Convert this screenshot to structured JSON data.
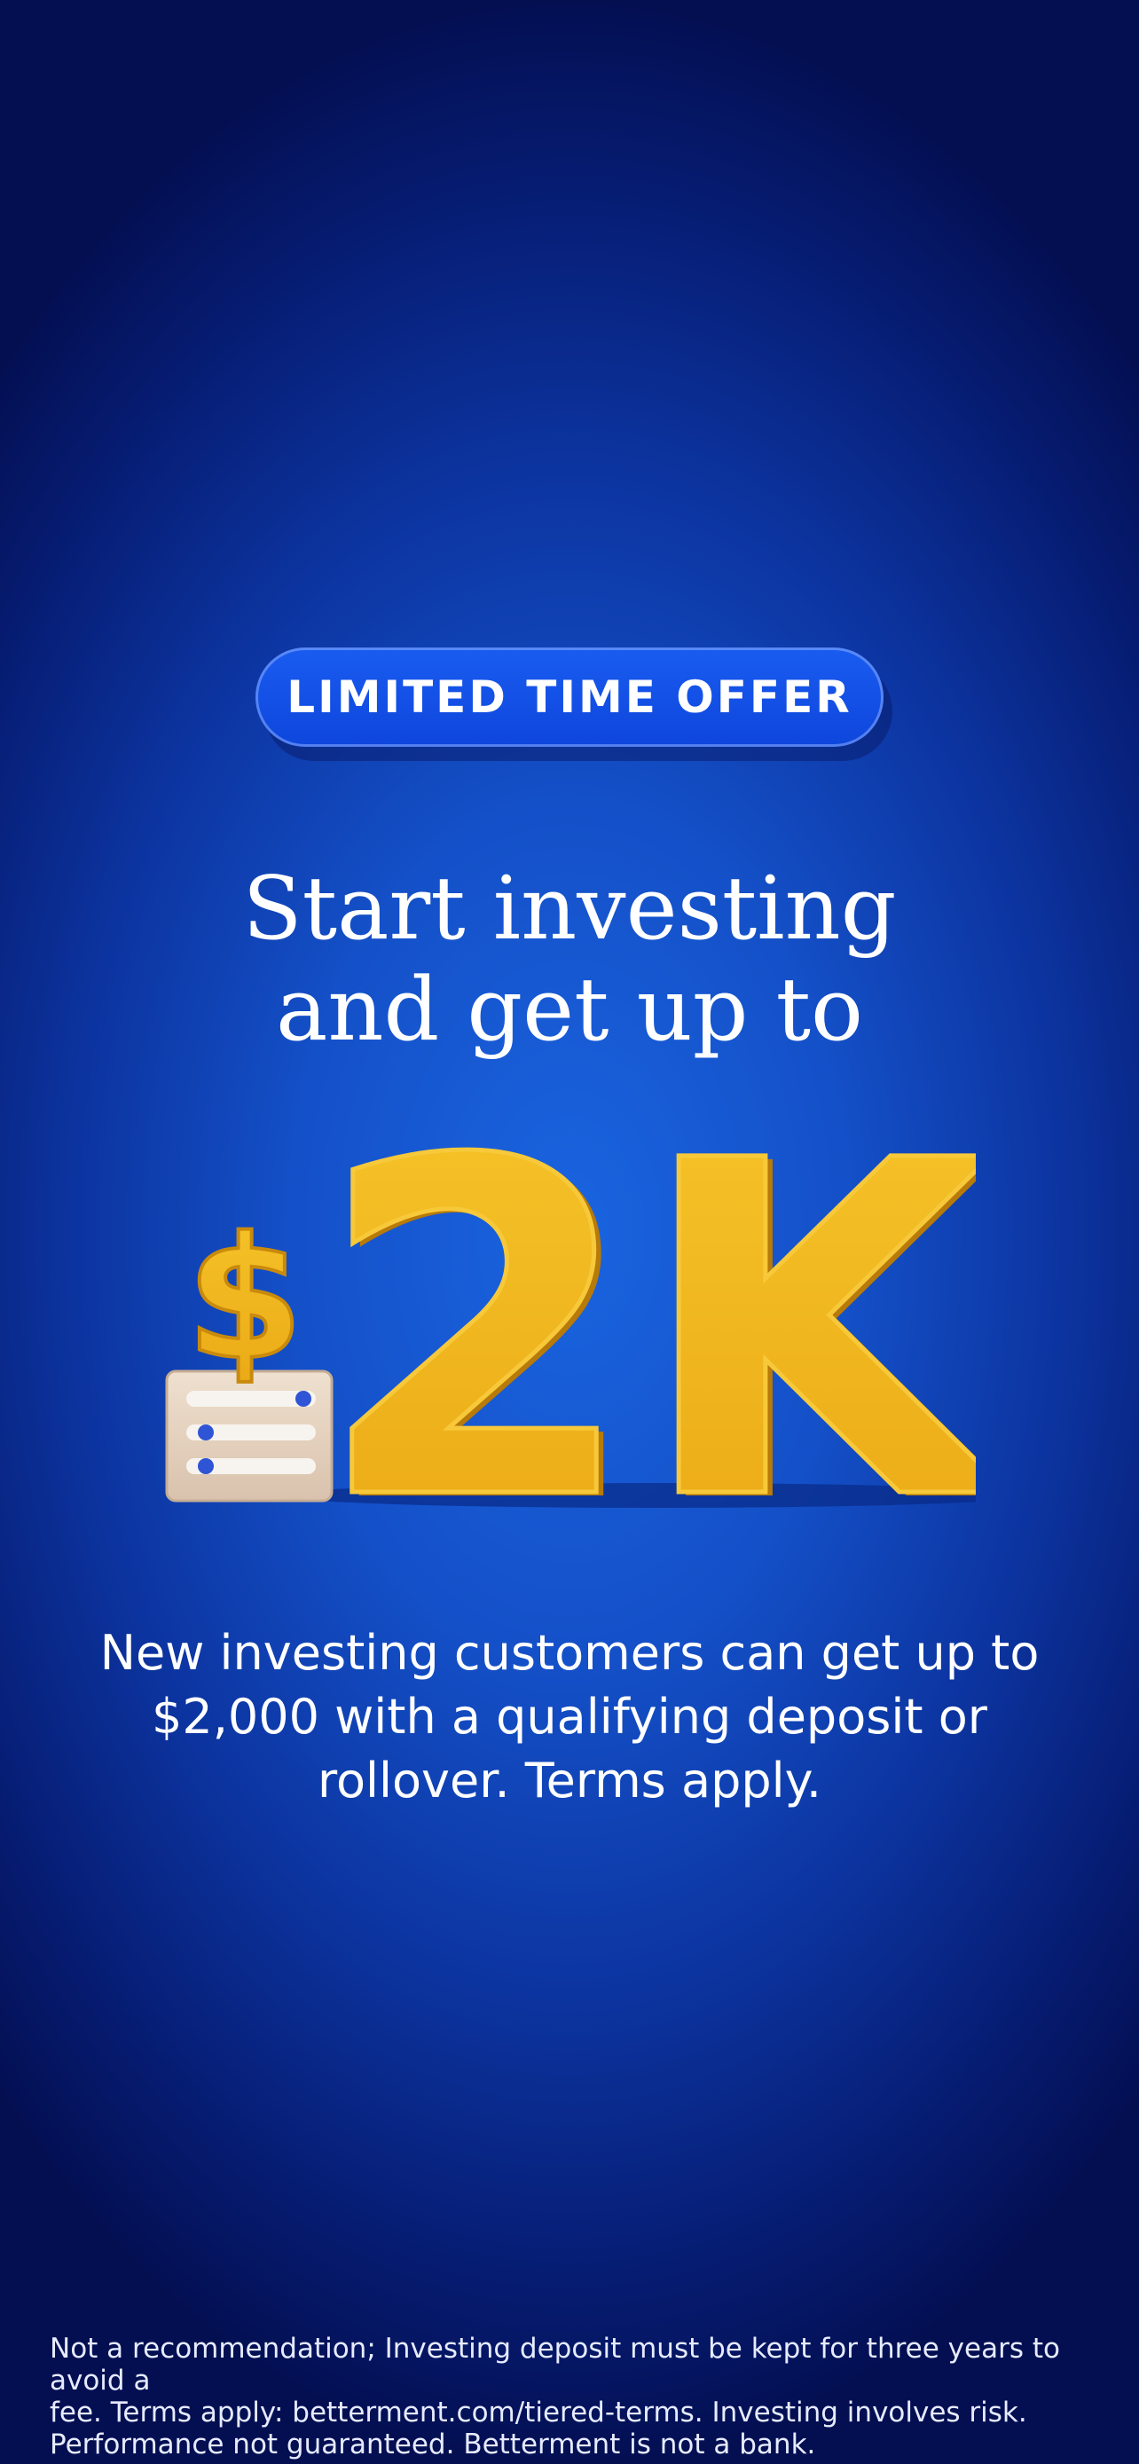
{
  "badge": {
    "label": "LIMITED TIME OFFER"
  },
  "headline": {
    "line1": "Start investing",
    "line2": "and get up to"
  },
  "hero": {
    "dollar_sign": "$",
    "amount": "2K",
    "icon": "dollar-on-box-icon"
  },
  "subtext": {
    "line1": "New investing customers can get up to",
    "line2": "$2,000 with a qualifying deposit or",
    "line3": "rollover. Terms apply."
  },
  "disclaimer": {
    "line1": "Not a recommendation; Investing deposit must be kept for three years to avoid a",
    "line2": "fee. Terms apply: betterment.com/tiered-terms. Investing involves risk.",
    "line3": "Performance not guaranteed. Betterment is not a bank."
  },
  "colors": {
    "background_center": "#1a64e0",
    "background_edge": "#040f52",
    "badge": "#0e46dc",
    "gold": "#f2b61c",
    "text": "#ffffff"
  }
}
